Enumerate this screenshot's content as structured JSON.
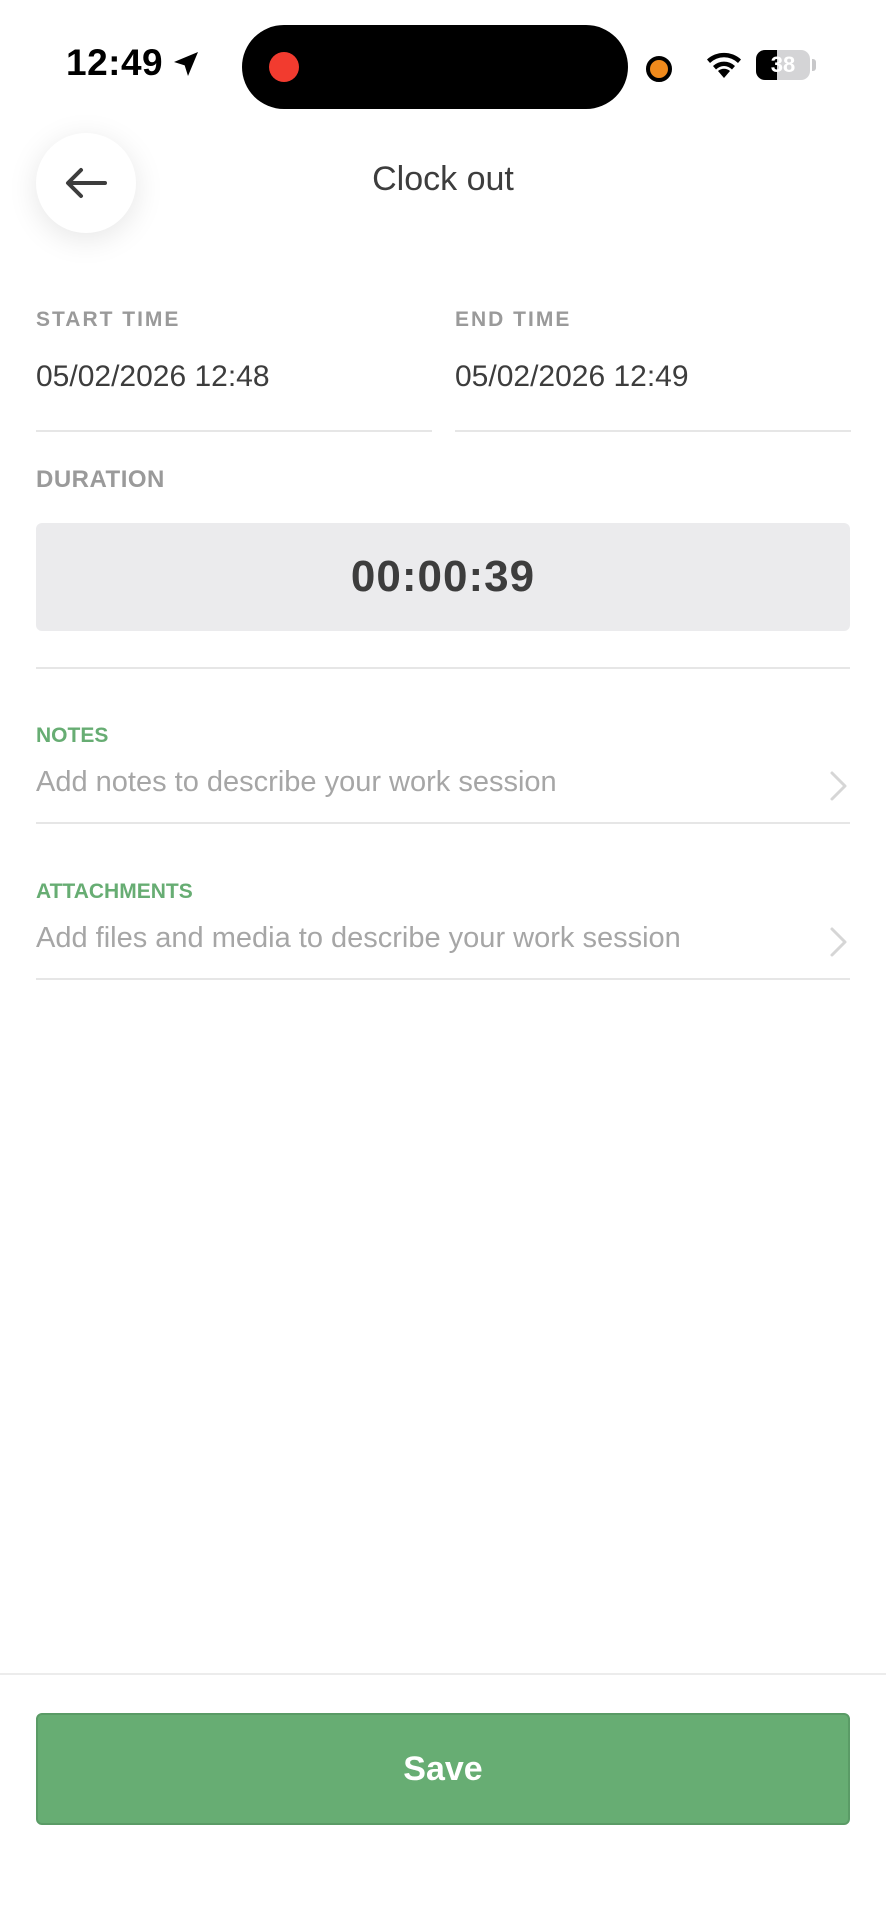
{
  "status_bar": {
    "time": "12:49",
    "battery_level": "38",
    "icons": [
      "location-arrow-icon",
      "recording-indicator-icon",
      "microphone-indicator-icon",
      "wifi-icon",
      "battery-icon"
    ],
    "colors": {
      "recording": "#f23b2f",
      "mic": "#f08a1c"
    }
  },
  "header": {
    "back_icon": "arrow-left-icon",
    "title": "Clock out"
  },
  "times": {
    "start_label": "START TIME",
    "start_value": "05/02/2026 12:48",
    "end_label": "END TIME",
    "end_value": "05/02/2026 12:49"
  },
  "duration": {
    "label": "DURATION",
    "value": "00:00:39"
  },
  "notes": {
    "label": "NOTES",
    "placeholder": "Add notes to describe your work session",
    "icon": "chevron-right-icon"
  },
  "attachments": {
    "label": "ATTACHMENTS",
    "placeholder": "Add files and media to describe your work session",
    "icon": "chevron-right-icon"
  },
  "footer": {
    "save_label": "Save"
  },
  "theme": {
    "accent": "#67ad73",
    "text": "#3d3d3d",
    "muted": "#9a9a9a"
  }
}
